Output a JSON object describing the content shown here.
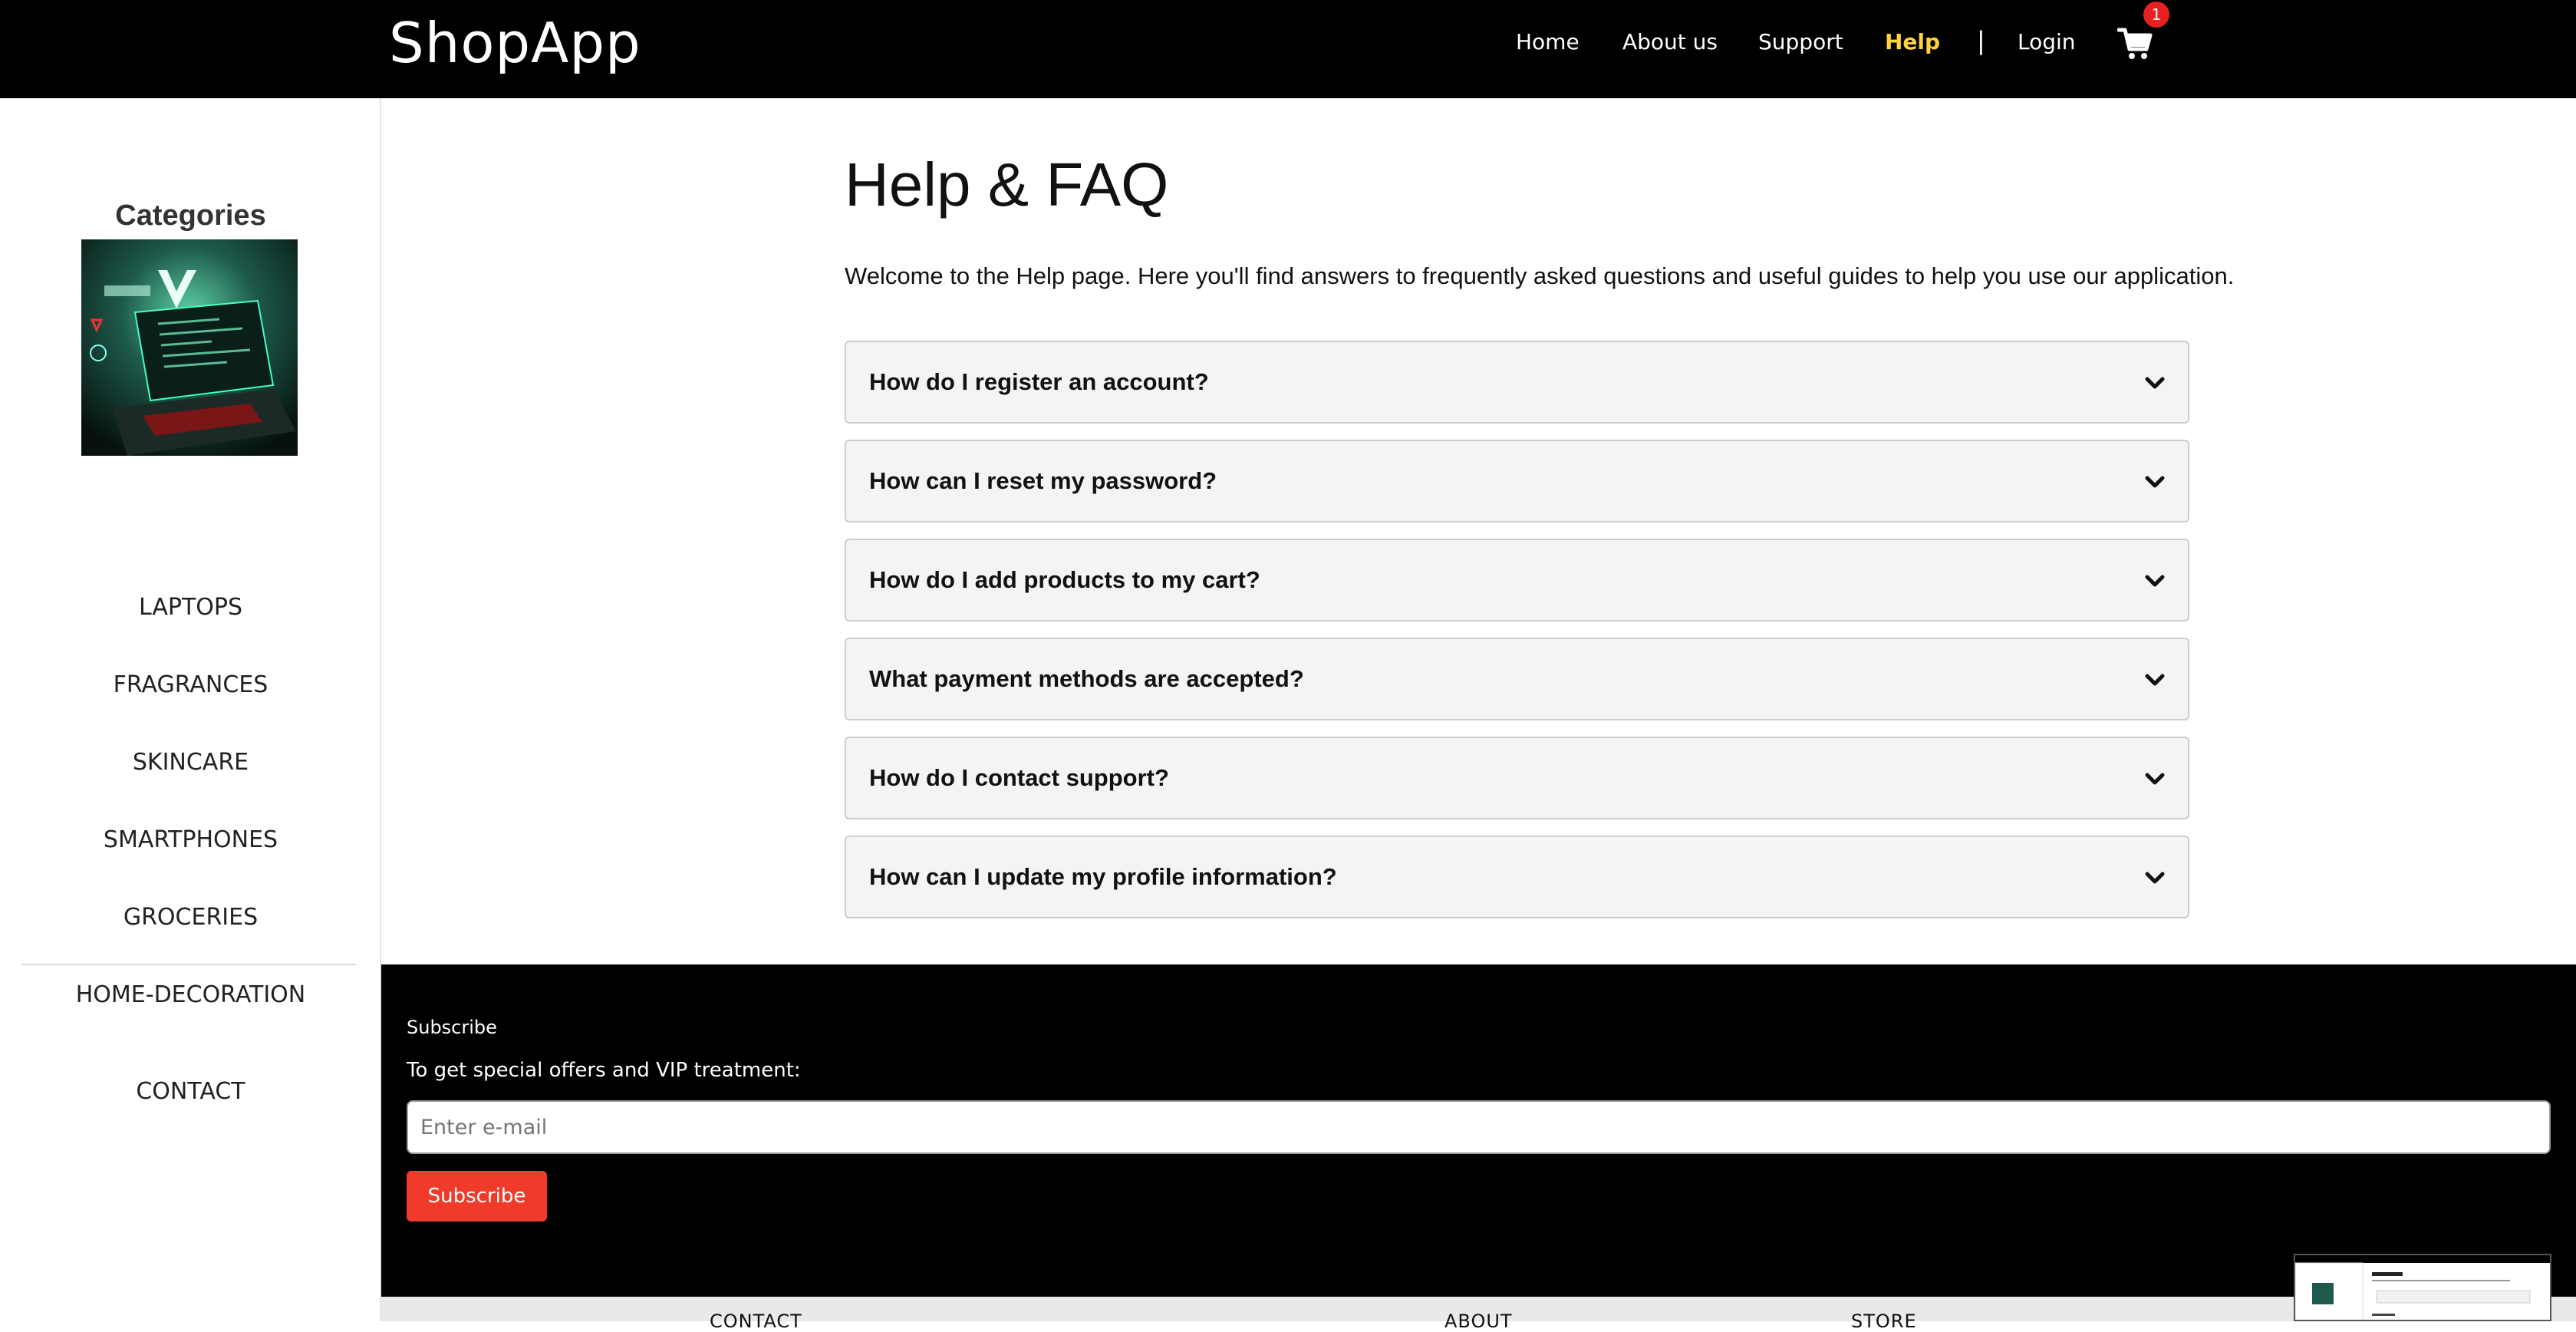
{
  "header": {
    "brand": "ShopApp",
    "nav": [
      {
        "label": "Home"
      },
      {
        "label": "About us"
      },
      {
        "label": "Support"
      },
      {
        "label": "Help",
        "active": true
      },
      {
        "label": "Login"
      }
    ],
    "separator": "|",
    "cart_count": "1",
    "cart_icon": "shopping-cart-icon",
    "accent_color": "#ffd43b",
    "badge_color": "#e8201f"
  },
  "sidebar": {
    "title": "Categories",
    "items": [
      {
        "label": "LAPTOPS"
      },
      {
        "label": "FRAGRANCES"
      },
      {
        "label": "SKINCARE"
      },
      {
        "label": "SMARTPHONES"
      },
      {
        "label": "GROCERIES"
      },
      {
        "label": "HOME-DECORATION"
      }
    ],
    "contact": "CONTACT"
  },
  "main": {
    "title": "Help & FAQ",
    "intro": "Welcome to the Help page. Here you'll find answers to frequently asked questions and useful guides to help you use our application.",
    "faqs": [
      {
        "question": "How do I register an account?"
      },
      {
        "question": "How can I reset my password?"
      },
      {
        "question": "How do I add products to my cart?"
      },
      {
        "question": "What payment methods are accepted?"
      },
      {
        "question": "How do I contact support?"
      },
      {
        "question": "How can I update my profile information?"
      }
    ]
  },
  "footer": {
    "subscribe_title": "Subscribe",
    "subscribe_text": "To get special offers and VIP treatment:",
    "email_placeholder": "Enter e-mail",
    "subscribe_button": "Subscribe",
    "button_color": "#f03b2b",
    "columns": [
      "CONTACT",
      "ABOUT",
      "STORE"
    ]
  }
}
